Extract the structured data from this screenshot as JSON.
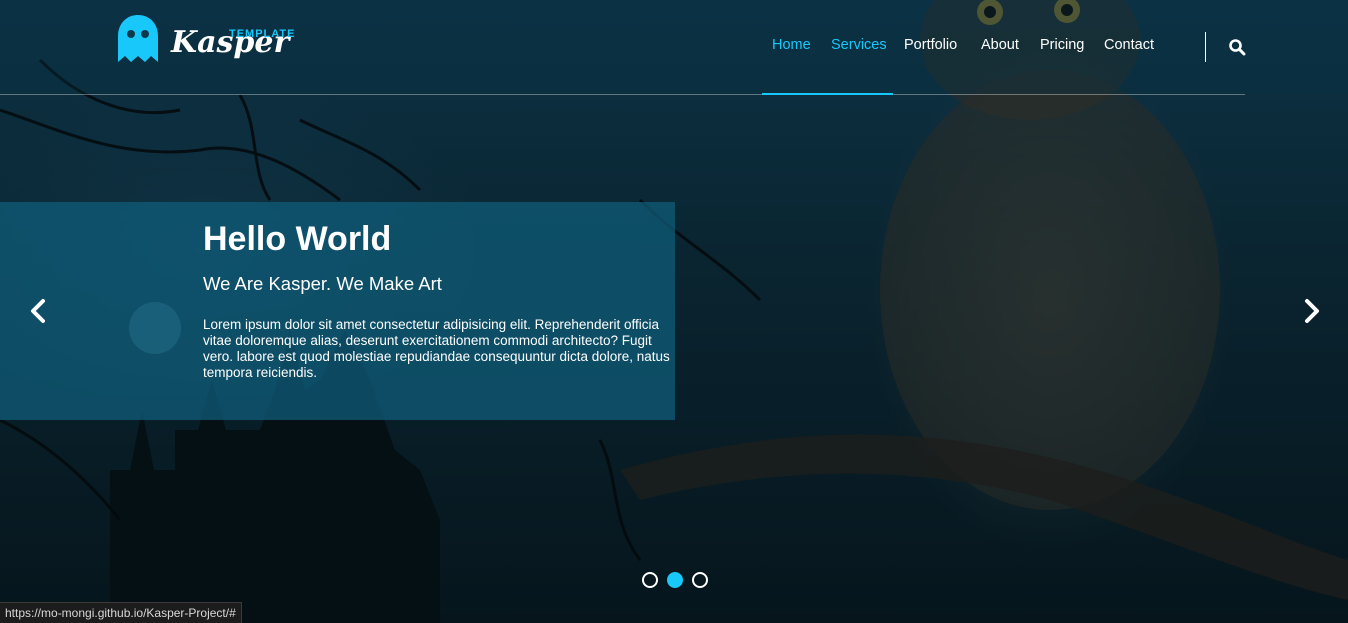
{
  "brand": {
    "small_label": "TEMPLATE",
    "wordmark": "Kasper",
    "logo_icon": "ghost-icon",
    "accent_color": "#19c8fa"
  },
  "nav": {
    "items": [
      {
        "label": "Home",
        "active": true
      },
      {
        "label": "Services",
        "active": true
      },
      {
        "label": "Portfolio",
        "active": false
      },
      {
        "label": "About",
        "active": false
      },
      {
        "label": "Pricing",
        "active": false
      },
      {
        "label": "Contact",
        "active": false
      }
    ],
    "search_icon": "search-icon"
  },
  "hero": {
    "title": "Hello World",
    "subtitle": "We Are Kasper. We Make Art",
    "body": "Lorem ipsum dolor sit amet consectetur adipisicing elit. Reprehenderit officia vitae doloremque alias, deserunt exercitationem commodi architecto? Fugit vero. labore est quod molestiae repudiandae consequuntur dicta dolore, natus tempora reiciendis.",
    "prev_icon": "chevron-left-icon",
    "next_icon": "chevron-right-icon"
  },
  "slider": {
    "slide_count": 3,
    "active_index": 1
  },
  "status_bar": {
    "url": "https://mo-mongi.github.io/Kasper-Project/#"
  }
}
